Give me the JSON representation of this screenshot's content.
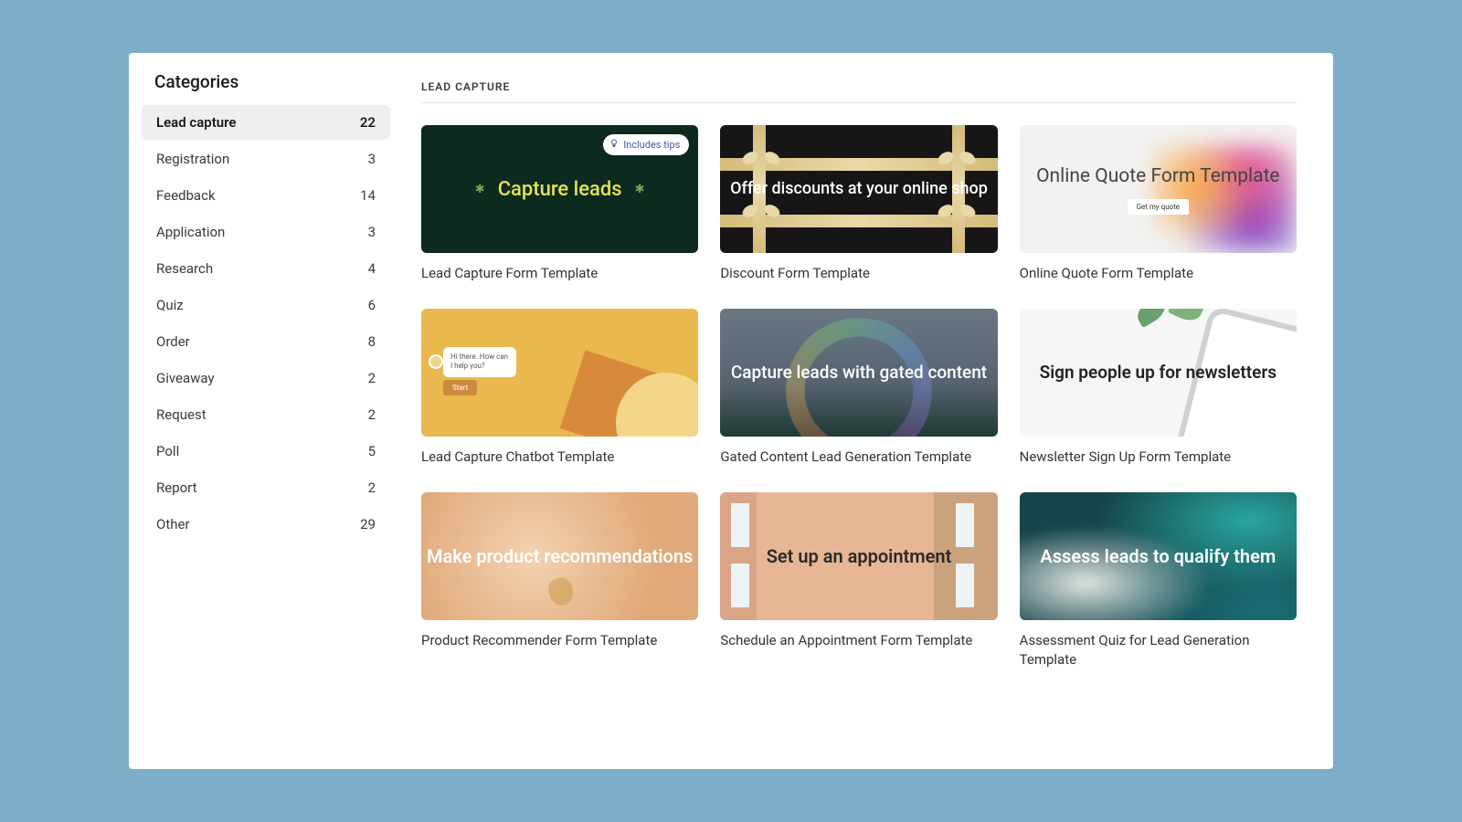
{
  "sidebar": {
    "title": "Categories",
    "items": [
      {
        "label": "Lead capture",
        "count": "22",
        "active": true
      },
      {
        "label": "Registration",
        "count": "3"
      },
      {
        "label": "Feedback",
        "count": "14"
      },
      {
        "label": "Application",
        "count": "3"
      },
      {
        "label": "Research",
        "count": "4"
      },
      {
        "label": "Quiz",
        "count": "6"
      },
      {
        "label": "Order",
        "count": "8"
      },
      {
        "label": "Giveaway",
        "count": "2"
      },
      {
        "label": "Request",
        "count": "2"
      },
      {
        "label": "Poll",
        "count": "5"
      },
      {
        "label": "Report",
        "count": "2"
      },
      {
        "label": "Other",
        "count": "29"
      }
    ]
  },
  "section": {
    "title": "LEAD CAPTURE"
  },
  "cards": [
    {
      "title": "Lead Capture Form Template",
      "headline": "Capture leads",
      "badge": "Includes tips"
    },
    {
      "title": "Discount Form Template",
      "headline": "Offer discounts at your online shop"
    },
    {
      "title": "Online Quote Form Template",
      "headline": "Online Quote Form Template",
      "cta": "Get my quote"
    },
    {
      "title": "Lead Capture Chatbot Template",
      "bubble": "Hi there. How can I help you?",
      "cta": "Start"
    },
    {
      "title": "Gated Content Lead Generation Template",
      "headline": "Capture leads with gated content"
    },
    {
      "title": "Newsletter Sign Up Form Template",
      "headline": "Sign people up for newsletters"
    },
    {
      "title": "Product Recommender Form Template",
      "headline": "Make product recommendations"
    },
    {
      "title": "Schedule an Appointment Form Template",
      "headline": "Set up an appointment"
    },
    {
      "title": "Assessment Quiz for Lead Generation Template",
      "headline": "Assess leads to qualify them"
    }
  ]
}
